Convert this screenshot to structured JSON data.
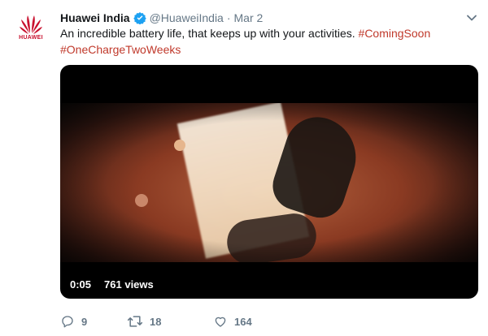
{
  "tweet": {
    "avatar": {
      "brand": "HUAWEI",
      "icon": "huawei-logo-icon",
      "color": "#c8102e"
    },
    "author_name": "Huawei India",
    "handle": "@HuaweiIndia",
    "separator": "·",
    "date": "Mar 2",
    "text": "An incredible battery life, that keeps up with your activities.",
    "hashtags": [
      "#ComingSoon",
      "#OneChargeTwoWeeks"
    ],
    "hashtag_color": "#c0392b",
    "verified_icon": "verified-badge-icon",
    "menu_icon": "chevron-down-icon"
  },
  "media": {
    "duration": "0:05",
    "views": "761 views"
  },
  "actions": {
    "replies": "9",
    "retweets": "18",
    "likes": "164"
  }
}
